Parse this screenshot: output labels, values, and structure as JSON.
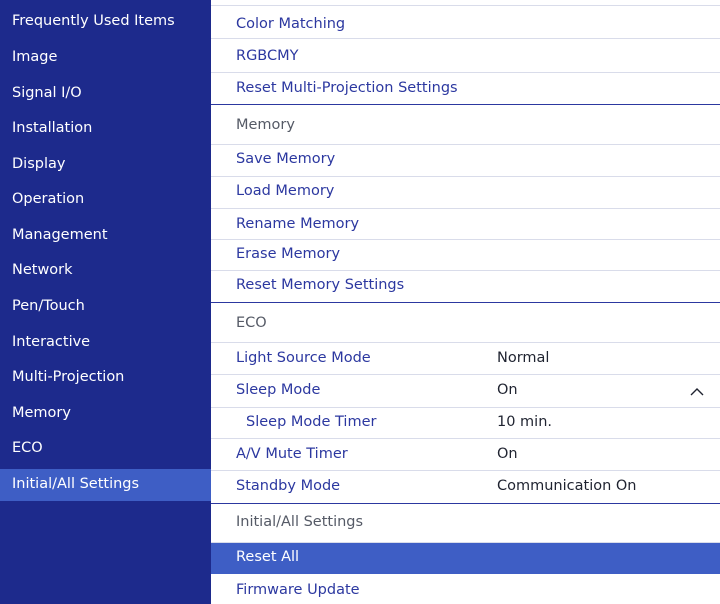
{
  "sidebar": {
    "items": [
      {
        "label": "Frequently Used Items"
      },
      {
        "label": "Image"
      },
      {
        "label": "Signal I/O"
      },
      {
        "label": "Installation"
      },
      {
        "label": "Display"
      },
      {
        "label": "Operation"
      },
      {
        "label": "Management"
      },
      {
        "label": "Network"
      },
      {
        "label": "Pen/Touch"
      },
      {
        "label": "Interactive"
      },
      {
        "label": "Multi-Projection"
      },
      {
        "label": "Memory"
      },
      {
        "label": "ECO"
      },
      {
        "label": "Initial/All Settings"
      }
    ],
    "selected": "Initial/All Settings"
  },
  "main": {
    "rows": [
      {
        "label": "Color Matching"
      },
      {
        "label": "RGBCMY"
      },
      {
        "label": "Reset Multi-Projection Settings"
      },
      {
        "label": "Memory"
      },
      {
        "label": "Save Memory"
      },
      {
        "label": "Load Memory"
      },
      {
        "label": "Rename Memory"
      },
      {
        "label": "Erase Memory"
      },
      {
        "label": "Reset Memory Settings"
      },
      {
        "label": "ECO"
      },
      {
        "label": "Light Source Mode",
        "value": "Normal"
      },
      {
        "label": "Sleep Mode",
        "value": "On"
      },
      {
        "label": "Sleep Mode Timer",
        "value": "10 min."
      },
      {
        "label": "A/V Mute Timer",
        "value": "On"
      },
      {
        "label": "Standby Mode",
        "value": "Communication On"
      },
      {
        "label": "Initial/All Settings"
      },
      {
        "label": "Reset All"
      },
      {
        "label": "Firmware Update"
      }
    ],
    "selected": "Reset All"
  },
  "icons": {
    "sleep_mode_expand": "chevron-up-icon"
  },
  "colors": {
    "sidebar_bg": "#1d2a8c",
    "selected_bg": "#3e5ec5",
    "item_text": "#2c38a0",
    "section_text": "#555a66"
  }
}
